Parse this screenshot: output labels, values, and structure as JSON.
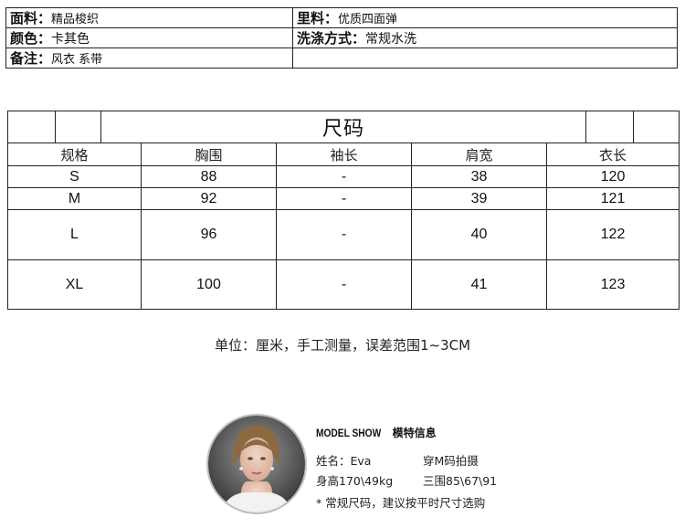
{
  "fabric": {
    "rows": [
      [
        {
          "key": "面料：",
          "val": "精品梭织"
        },
        {
          "key": "里料：",
          "val": "优质四面弹"
        }
      ],
      [
        {
          "key": "颜色：",
          "val": "卡其色"
        },
        {
          "key": "洗涤方式：",
          "val": "常规水洗"
        }
      ],
      [
        {
          "key": "备注：",
          "val": "风衣 系带"
        },
        {
          "key": "",
          "val": ""
        }
      ]
    ]
  },
  "size_table": {
    "title": "尺码",
    "headers": [
      "规格",
      "胸围",
      "袖长",
      "肩宽",
      "衣长"
    ],
    "rows": [
      [
        "S",
        "88",
        "-",
        "38",
        "120"
      ],
      [
        "M",
        "92",
        "-",
        "39",
        "121"
      ],
      [
        "L",
        "96",
        "-",
        "40",
        "122"
      ],
      [
        "XL",
        "100",
        "-",
        "41",
        "123"
      ]
    ]
  },
  "note": "单位：厘米，手工测量，误差范围1~3CM",
  "model": {
    "title_en": "MODEL SHOW",
    "title_cn": "模特信息",
    "name": "姓名：Eva",
    "size_worn": "穿M码拍摄",
    "height_weight": "身高170\\49kg",
    "measurements": "三围85\\67\\91",
    "advice": "* 常规尺码，建议按平时尺寸选购"
  }
}
